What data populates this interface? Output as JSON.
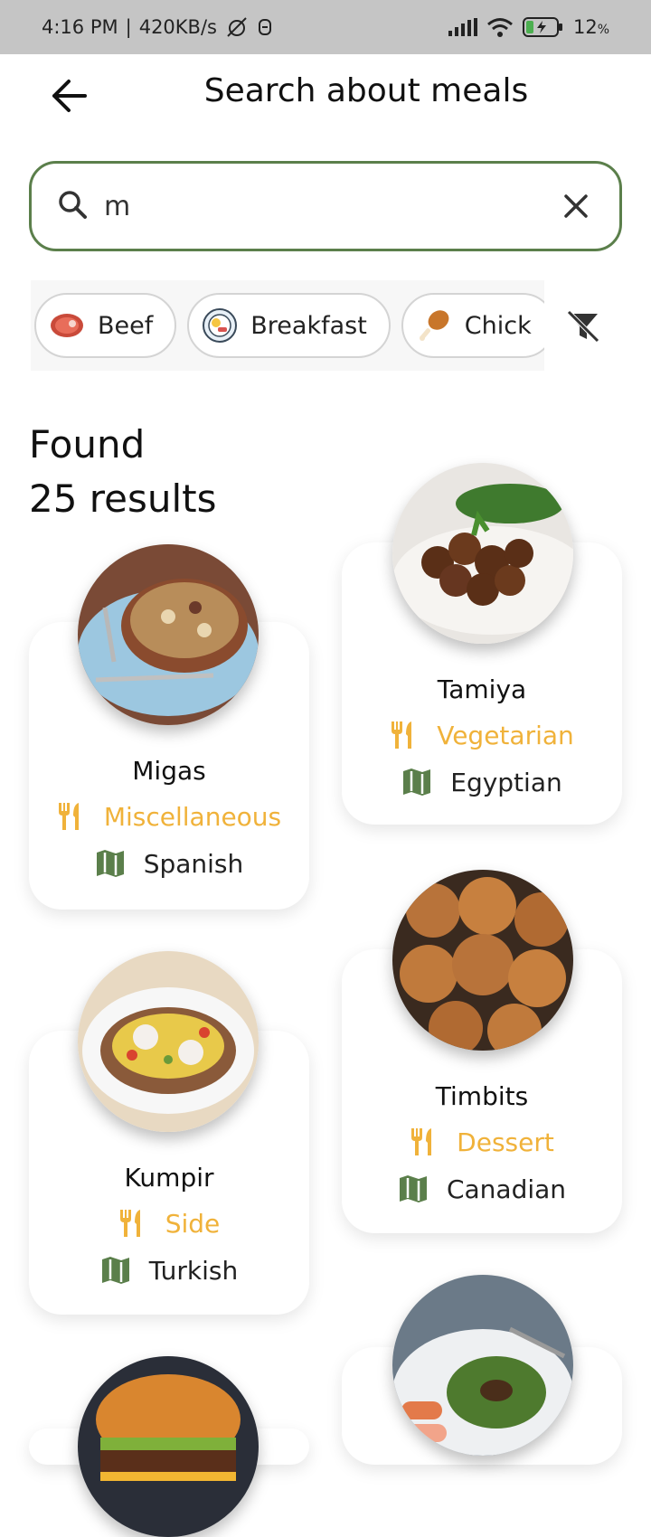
{
  "status": {
    "time": "4:16 PM",
    "speed": "420KB/s",
    "battery": "12"
  },
  "header": {
    "title": "Search about meals"
  },
  "search": {
    "value": "m",
    "placeholder": ""
  },
  "chips": [
    {
      "label": "Beef",
      "icon": "steak-icon"
    },
    {
      "label": "Breakfast",
      "icon": "breakfast-plate-icon"
    },
    {
      "label": "Chick",
      "icon": "drumstick-icon"
    }
  ],
  "results": {
    "line1": "Found",
    "line2": "25 results"
  },
  "meals": [
    {
      "name": "Migas",
      "category": "Miscellaneous",
      "area": "Spanish"
    },
    {
      "name": "Tamiya",
      "category": "Vegetarian",
      "area": "Egyptian"
    },
    {
      "name": "Kumpir",
      "category": "Side",
      "area": "Turkish"
    },
    {
      "name": "Timbits",
      "category": "Dessert",
      "area": "Canadian"
    }
  ],
  "colors": {
    "accent_green": "#5b7f4b",
    "category_yellow": "#f0b23a"
  }
}
